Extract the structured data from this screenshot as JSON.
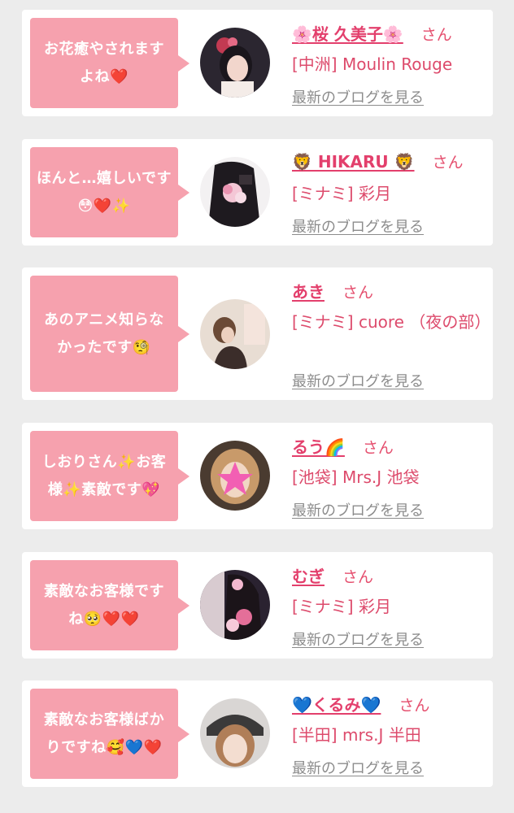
{
  "cards": [
    {
      "message": "お花癒やされますよね❤️",
      "name": "🌸桜 久美子🌸",
      "honorific": "さん",
      "shop": "[中洲] Moulin Rouge",
      "blog_link": "最新のブログを見る"
    },
    {
      "message": "ほんと…嬉しいです😳❤️✨",
      "name": "🦁 HIKARU 🦁",
      "honorific": "さん",
      "shop": "[ミナミ] 彩月",
      "blog_link": "最新のブログを見る"
    },
    {
      "message": "あのアニメ知らなかったです🧐",
      "name": "あき",
      "honorific": "さん",
      "shop": "[ミナミ] cuore （夜の部）",
      "blog_link": "最新のブログを見る"
    },
    {
      "message": "しおりさん✨お客様✨素敵です💖",
      "name": "るう🌈",
      "honorific": "さん",
      "shop": "[池袋] Mrs.J 池袋",
      "blog_link": "最新のブログを見る"
    },
    {
      "message": "素敵なお客様ですね🥺❤️❤️",
      "name": "むぎ",
      "honorific": "さん",
      "shop": "[ミナミ] 彩月",
      "blog_link": "最新のブログを見る"
    },
    {
      "message": "素敵なお客様ばかりですね🥰💙❤️",
      "name": "💙くるみ💙",
      "honorific": "さん",
      "shop": "[半田] mrs.J 半田",
      "blog_link": "最新のブログを見る"
    }
  ],
  "colors": {
    "bubble": "#f6a1ae",
    "name": "#e33f6c",
    "shop": "#dd4b6c",
    "link": "#8c8c8c",
    "background": "#ececec"
  }
}
